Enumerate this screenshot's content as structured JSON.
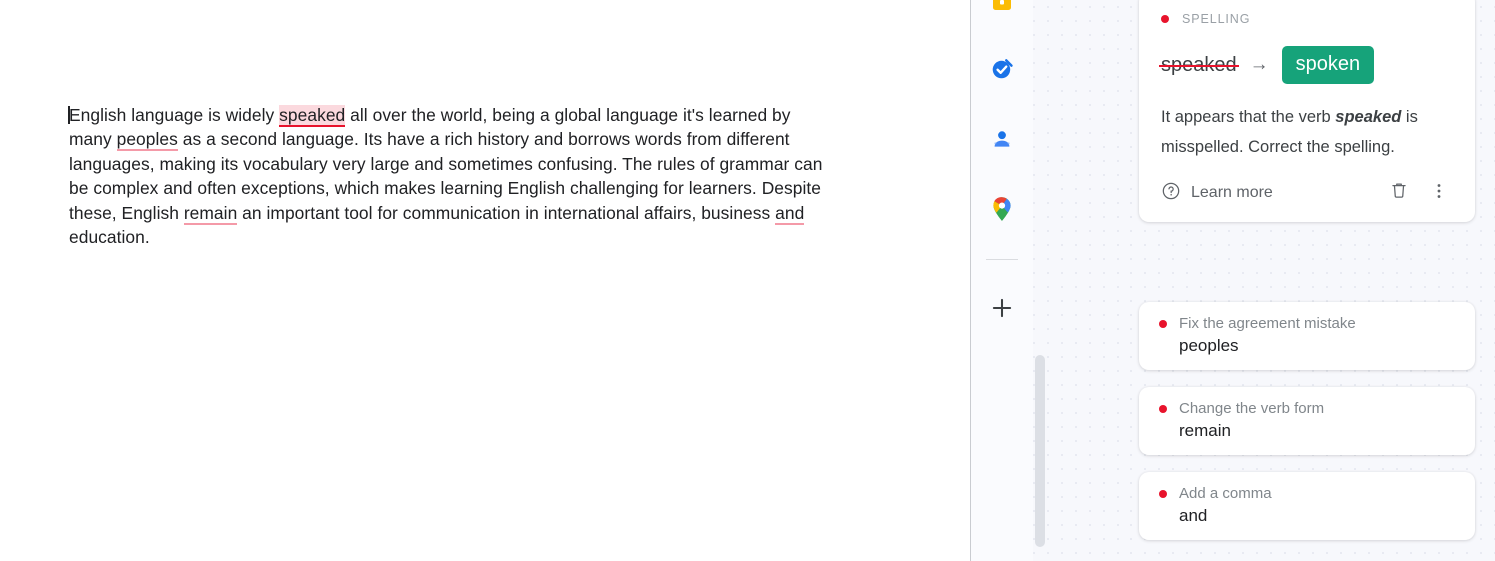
{
  "document": {
    "text_segments": [
      {
        "t": "English language is widely ",
        "style": "normal"
      },
      {
        "t": "speaked",
        "style": "active"
      },
      {
        "t": " all over the world, being a global language it's learned by many ",
        "style": "normal"
      },
      {
        "t": "peoples",
        "style": "flagged"
      },
      {
        "t": " as a second language. Its have a rich history and borrows words from different languages, making its vocabulary very large and sometimes confusing. The rules of grammar can be complex and often exceptions, which makes learning English challenging for learners. Despite these, English ",
        "style": "normal"
      },
      {
        "t": "remain",
        "style": "flagged"
      },
      {
        "t": " an important tool for communication in international affairs, business ",
        "style": "normal"
      },
      {
        "t": "and",
        "style": "flagged"
      },
      {
        "t": " education.",
        "style": "normal"
      }
    ]
  },
  "side_rail": {
    "items": [
      {
        "icon": "google-keep-icon",
        "label": "Keep"
      },
      {
        "icon": "google-tasks-icon",
        "label": "Tasks"
      },
      {
        "icon": "google-contacts-icon",
        "label": "Contacts"
      },
      {
        "icon": "google-maps-icon",
        "label": "Maps"
      }
    ],
    "add_button": {
      "icon": "plus-icon",
      "label": "+"
    }
  },
  "suggestions_panel": {
    "main_card": {
      "category": "SPELLING",
      "original_word": "speaked",
      "arrow": "→",
      "suggested_word": "spoken",
      "explanation_prefix": "It appears that the verb ",
      "explanation_bold": "speaked",
      "explanation_suffix": " is misspelled. Correct the spelling.",
      "learn_more_label": "Learn more",
      "help_icon": "help-circle-icon",
      "delete_icon": "trash-icon",
      "more_icon": "more-vertical-icon"
    },
    "cards": [
      {
        "title": "Fix the agreement mistake",
        "word": "peoples"
      },
      {
        "title": "Change the verb form",
        "word": "remain"
      },
      {
        "title": "Add a comma",
        "word": "and"
      }
    ]
  },
  "colors": {
    "accent_green": "#16a37a",
    "error_red": "#e8132c",
    "highlight_pink": "#fbd9de",
    "underline_pink": "#f49aa8",
    "text_primary": "#202124",
    "text_secondary": "#5f6368",
    "text_muted": "#9aa0a6",
    "panel_bg": "#f7f8fc"
  }
}
